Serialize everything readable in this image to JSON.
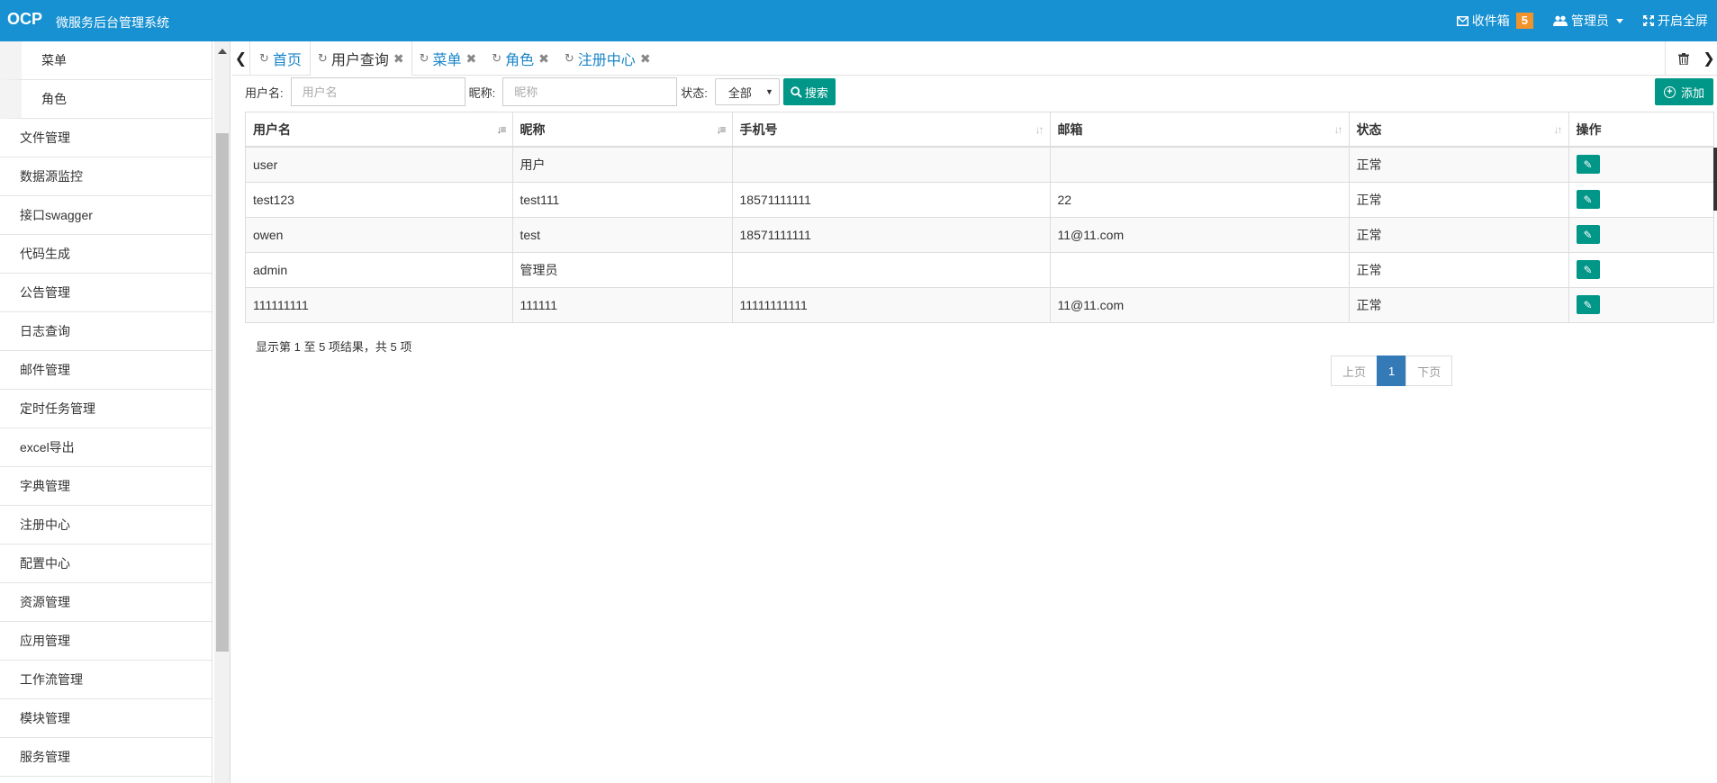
{
  "header": {
    "brand": "OCP",
    "system_name": "微服务后台管理系统",
    "inbox_label": "收件箱",
    "inbox_count": "5",
    "user_label": "管理员",
    "fullscreen_label": "开启全屏"
  },
  "sidebar": {
    "sub_items": [
      {
        "label": "菜单"
      },
      {
        "label": "角色"
      }
    ],
    "items": [
      {
        "label": "文件管理"
      },
      {
        "label": "数据源监控"
      },
      {
        "label": "接口swagger"
      },
      {
        "label": "代码生成"
      },
      {
        "label": "公告管理"
      },
      {
        "label": "日志查询"
      },
      {
        "label": "邮件管理"
      },
      {
        "label": "定时任务管理"
      },
      {
        "label": "excel导出"
      },
      {
        "label": "字典管理"
      },
      {
        "label": "注册中心"
      },
      {
        "label": "配置中心"
      },
      {
        "label": "资源管理"
      },
      {
        "label": "应用管理"
      },
      {
        "label": "工作流管理"
      },
      {
        "label": "模块管理"
      },
      {
        "label": "服务管理"
      }
    ]
  },
  "tabs": [
    {
      "label": "首页",
      "closable": false
    },
    {
      "label": "用户查询",
      "closable": true,
      "active": true
    },
    {
      "label": "菜单",
      "closable": true
    },
    {
      "label": "角色",
      "closable": true
    },
    {
      "label": "注册中心",
      "closable": true
    }
  ],
  "search": {
    "username_label": "用户名:",
    "username_placeholder": "用户名",
    "nickname_label": "昵称:",
    "nickname_placeholder": "昵称",
    "status_label": "状态:",
    "status_value": "全部",
    "search_button": "搜索",
    "add_button": "添加"
  },
  "table": {
    "columns": [
      "用户名",
      "昵称",
      "手机号",
      "邮箱",
      "状态",
      "操作"
    ],
    "rows": [
      [
        "user",
        "用户",
        "",
        "",
        "正常"
      ],
      [
        "test123",
        "test111",
        "18571111111",
        "22",
        "正常"
      ],
      [
        "owen",
        "test",
        "18571111111",
        "11@11.com",
        "正常"
      ],
      [
        "admin",
        "管理员",
        "",
        "",
        "正常"
      ],
      [
        "111111111",
        "111111",
        "11111111111",
        "11@11.com",
        "正常"
      ]
    ],
    "info": "显示第 1 至 5 项结果，共 5 项"
  },
  "pagination": {
    "prev": "上页",
    "current": "1",
    "next": "下页"
  },
  "colors": {
    "header_bg": "#1791d2",
    "primary_button": "#009688",
    "badge": "#f0932b",
    "page_active": "#337ab7"
  }
}
